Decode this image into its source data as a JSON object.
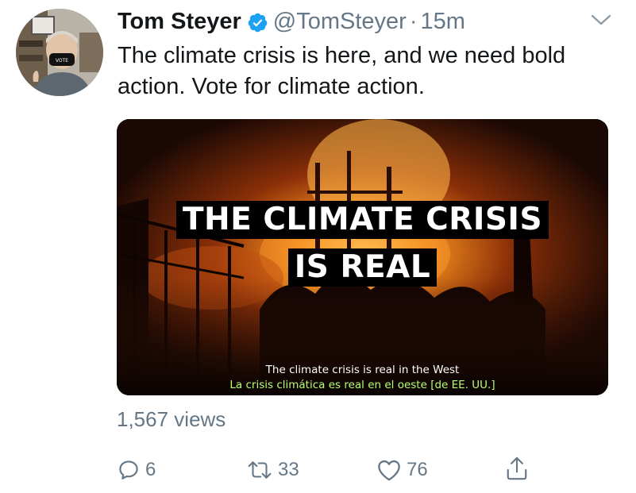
{
  "author": {
    "display_name": "Tom Steyer",
    "handle": "@TomSteyer",
    "separator": "·",
    "timestamp": "15m",
    "verified": true
  },
  "tweet": {
    "text": "The climate crisis is here, and we need bold action. Vote for climate action."
  },
  "media": {
    "type": "video",
    "overlay_title_line1": "THE CLIMATE CRISIS",
    "overlay_title_line2": "IS REAL",
    "subtitle_en": "The climate crisis is real in the West",
    "subtitle_es": "La crisis climática es real en el oeste [de EE. UU.]"
  },
  "stats": {
    "views": "1,567 views"
  },
  "actions": {
    "replies": "6",
    "retweets": "33",
    "likes": "76"
  },
  "icons": {
    "verified": "verified-badge-icon",
    "more": "chevron-down-icon",
    "reply": "reply-icon",
    "retweet": "retweet-icon",
    "like": "heart-icon",
    "share": "share-icon"
  },
  "colors": {
    "text": "#14171a",
    "muted": "#657786",
    "verified": "#1da1f2",
    "subtitle_es": "#b7ff70"
  }
}
